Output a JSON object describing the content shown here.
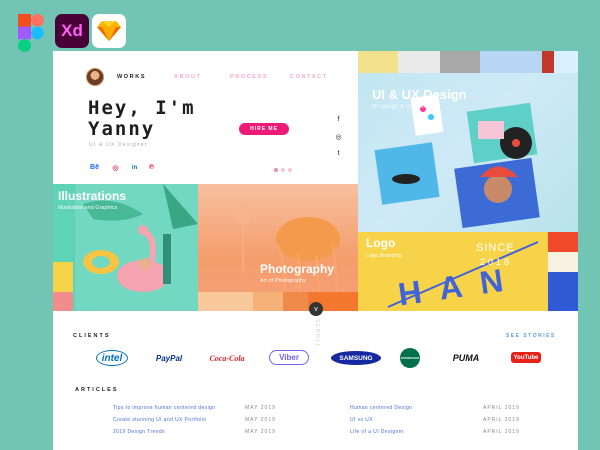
{
  "tools": {
    "xd_label": "Xd"
  },
  "nav": {
    "works": "WORKS",
    "about": "ABOUT",
    "process": "PROCESS",
    "contact": "CONTACT"
  },
  "hero": {
    "greeting": "Hey, I'm Yanny",
    "role": "UI & UX Designer",
    "hire_label": "HIRE ME",
    "social_left": [
      "Bē",
      "◎",
      "in",
      "℗"
    ],
    "social_right": [
      "f",
      "◎",
      "t"
    ]
  },
  "panels": {
    "uiux": {
      "title": "UI & UX Design",
      "subtitle": "UI Design & UX Design"
    },
    "illustrations": {
      "title": "Illustrations",
      "subtitle": "Illustration and Graphics"
    },
    "photography": {
      "title": "Photography",
      "subtitle": "Art of Photography"
    },
    "logo": {
      "title": "Logo",
      "subtitle": "Logo Branding",
      "since": "SINCE",
      "year": "2018",
      "letters": "HAN"
    }
  },
  "scroll": {
    "label": "v",
    "vertical_text": "SCROLL"
  },
  "clients": {
    "title": "CLIENTS",
    "see_stories": "SEE STORIES",
    "logos": [
      "intel",
      "PayPal",
      "Coca-Cola",
      "Viber",
      "SAMSUNG",
      "STARBUCKS",
      "PUMA",
      "YouTube"
    ]
  },
  "articles": {
    "title": "ARTICLES",
    "left": [
      {
        "title": "Tips to improve human centered design",
        "date": "MAY 2019"
      },
      {
        "title": "Create stunning UI and UX Portfolio",
        "date": "MAY 2019"
      },
      {
        "title": "2019 Design Trends",
        "date": "MAY 2019"
      }
    ],
    "right": [
      {
        "title": "Human centered Design",
        "date": "APRIL 2019"
      },
      {
        "title": "UI vs UX",
        "date": "APRIL 2019"
      },
      {
        "title": "Life of a UI Designer",
        "date": "APRIL 2019"
      }
    ]
  },
  "colors": {
    "background": "#72c4b5",
    "accent_pink": "#ec1b77",
    "link_blue": "#4a6fd8"
  }
}
